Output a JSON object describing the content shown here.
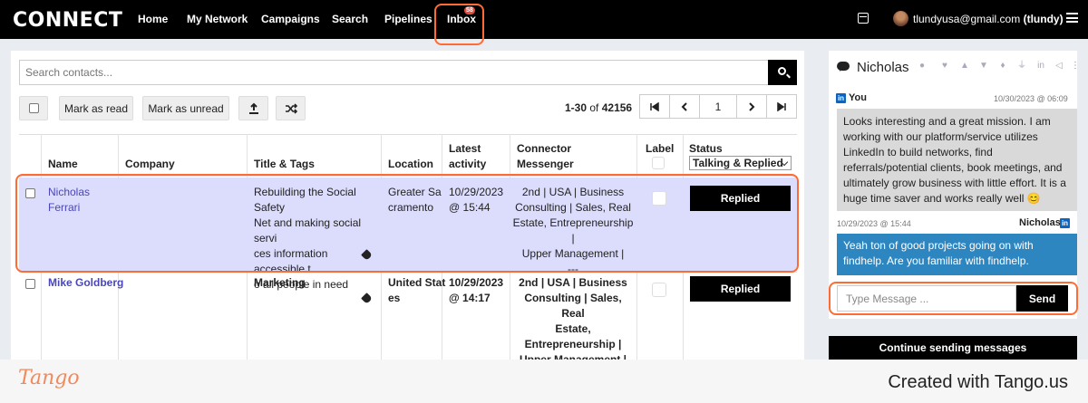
{
  "header": {
    "logo": "CONNECT",
    "nav": [
      "Home",
      "My Network",
      "Campaigns",
      "Search",
      "Pipelines",
      "Inbox"
    ],
    "inbox_badge": "58",
    "user_email": "tlundyusa@gmail.com",
    "user_handle": "(tlundy)"
  },
  "toolbar": {
    "search_placeholder": "Search contacts...",
    "mark_read": "Mark as read",
    "mark_unread": "Mark as unread",
    "range": "1-30",
    "of_label": "of",
    "total": "42156",
    "page": "1"
  },
  "table": {
    "headers": {
      "name": "Name",
      "company": "Company",
      "title_tags": "Title & Tags",
      "location": "Location",
      "latest": [
        "Latest",
        "activity"
      ],
      "connector": [
        "Connector",
        "Messenger"
      ],
      "label": "Label",
      "status": "Status"
    },
    "status_filter": "Talking & Replied",
    "rows": [
      {
        "name": [
          "Nicholas",
          "Ferrari"
        ],
        "company": "",
        "title": [
          "Rebuilding the Social Safety",
          "Net and making social servi",
          "ces information accessible t",
          "o all people in need"
        ],
        "location": [
          "Greater Sa",
          "cramento"
        ],
        "activity": [
          "10/29/2023",
          "@ 15:44"
        ],
        "connector": [
          "2nd | USA | Business",
          "Consulting | Sales, Real",
          "Estate, Entrepreneurship |",
          "Upper Management |",
          "---"
        ],
        "status": "Replied"
      },
      {
        "name": [
          "Mike Goldberg"
        ],
        "company": "",
        "title": [
          "Marketing"
        ],
        "location": [
          "United Stat",
          "es"
        ],
        "activity": [
          "10/29/2023",
          "@ 14:17"
        ],
        "connector": [
          "2nd | USA | Business",
          "Consulting | Sales, Real",
          "Estate, Entrepreneurship |",
          "Upper Management |",
          "---"
        ],
        "status": "Replied"
      }
    ]
  },
  "chat": {
    "contact": "Nicholas",
    "messages": [
      {
        "sender": "You",
        "time": "10/30/2023 @ 06:09",
        "text": "Looks interesting and a great mission. I am working with our platform/service utilizes LinkedIn to build networks, find referrals/potential clients, book meetings, and ultimately grow business with little effort. It is a huge time saver and works really well 😊"
      },
      {
        "sender": "Nicholas",
        "time": "10/29/2023 @ 15:44",
        "text": "Yeah ton of good projects going on with findhelp. Are you familiar with findhelp."
      }
    ],
    "input_placeholder": "Type Message ...",
    "send": "Send",
    "continue": "Continue sending messages",
    "linkedin_badge": "in"
  },
  "footer": {
    "logo": "Tango",
    "credit": "Created with Tango.us"
  },
  "colors": {
    "highlight": "#ff6b35",
    "selected_row": "#dcdcfc",
    "link": "#4b46b8",
    "bubble_them": "#2e86c1"
  }
}
